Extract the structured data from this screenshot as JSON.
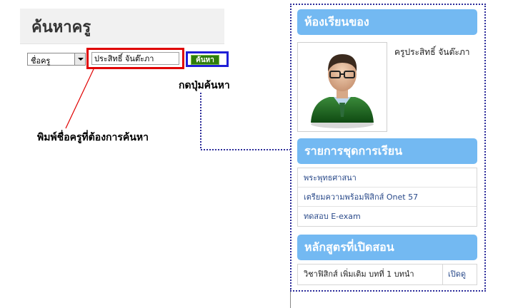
{
  "search": {
    "title": "ค้นหาครู",
    "field_selected": "ชื่อครู",
    "input_value": "ประสิทธิ์ จันต๊ะภา",
    "button_label": "ค้นหา"
  },
  "annotations": {
    "button_hint": "กดปุ่มค้นหา",
    "input_hint": "พิมพ์ชื่อครูที่ต้องการค้นหา"
  },
  "sidebar": {
    "classroom_title": "ห้องเรียนของ",
    "teacher_name": "ครูประสิทธิ์ จันต๊ะภา",
    "course_sets_title": "รายการชุดการเรียน",
    "course_sets": [
      {
        "label": "พระพุทธศาสนา"
      },
      {
        "label": "เตรียมความพร้อมฟิสิกส์ Onet 57"
      },
      {
        "label": "ทดสอบ E-exam"
      }
    ],
    "open_courses_title": "หลักสูตรที่เปิดสอน",
    "open_courses": [
      {
        "name": "วิชาฟิสิกส์ เพิ่มเติม บทที่ 1 บทนำ",
        "action": "เปิดดู"
      }
    ]
  },
  "colors": {
    "panel_header": "#73b9f2",
    "highlight_input": "#e00000",
    "highlight_button": "#1f1fd6",
    "search_button": "#2f7d0c",
    "connector_line": "#2b2b9a"
  }
}
